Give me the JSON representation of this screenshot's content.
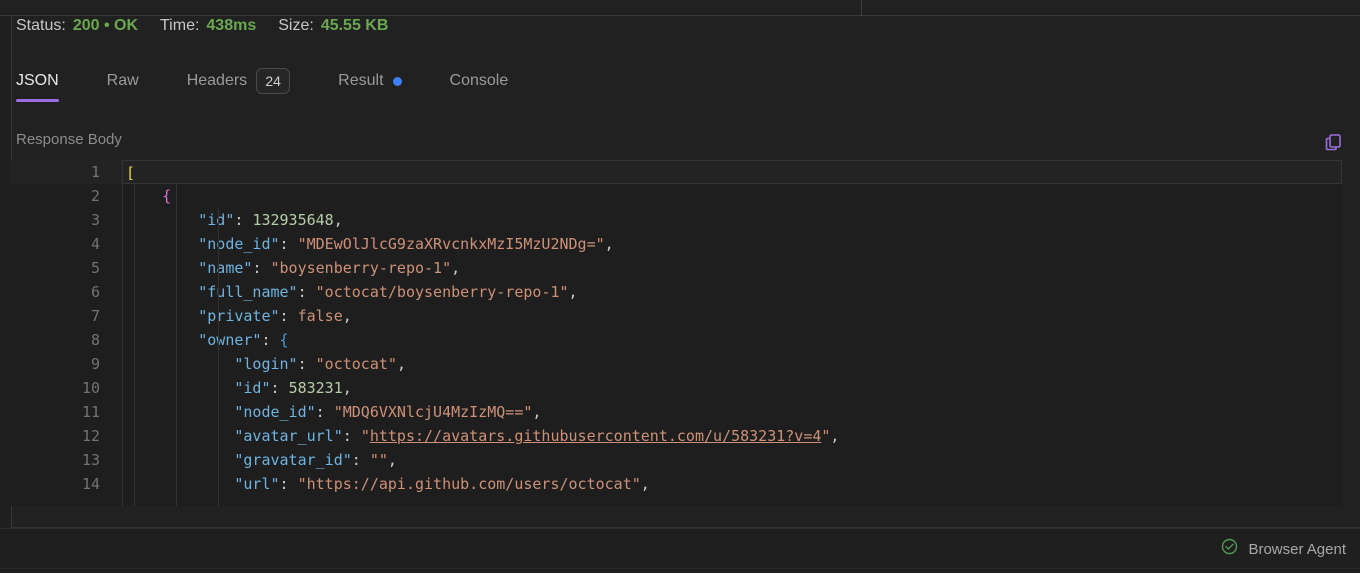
{
  "status_bar": {
    "status_label": "Status:",
    "status_value": "200 • OK",
    "status_color": "#6aa84f",
    "time_label": "Time:",
    "time_value": "438ms",
    "size_label": "Size:",
    "size_value": "45.55 KB"
  },
  "tabs": [
    {
      "label": "JSON",
      "active": true,
      "badge": null,
      "dot": null
    },
    {
      "label": "Raw",
      "active": false,
      "badge": null,
      "dot": null
    },
    {
      "label": "Headers",
      "active": false,
      "badge": "24",
      "dot": null
    },
    {
      "label": "Result",
      "active": false,
      "badge": null,
      "dot": "#3b82f6"
    },
    {
      "label": "Console",
      "active": false,
      "badge": null,
      "dot": null
    }
  ],
  "body_panel": {
    "title": "Response Body",
    "copy_icon": "copy-icon",
    "accent_color": "#9a6ee0"
  },
  "code": {
    "language": "json",
    "current_line": 1,
    "lines": [
      {
        "n": "1",
        "tokens": [
          {
            "t": "[",
            "c": "br0"
          }
        ]
      },
      {
        "n": "2",
        "tokens": [
          {
            "t": "    ",
            "c": "p"
          },
          {
            "t": "{",
            "c": "br1"
          }
        ]
      },
      {
        "n": "3",
        "tokens": [
          {
            "t": "        ",
            "c": "p"
          },
          {
            "t": "\"id\"",
            "c": "k"
          },
          {
            "t": ": ",
            "c": "p"
          },
          {
            "t": "132935648",
            "c": "n"
          },
          {
            "t": ",",
            "c": "p"
          }
        ]
      },
      {
        "n": "4",
        "tokens": [
          {
            "t": "        ",
            "c": "p"
          },
          {
            "t": "\"node_id\"",
            "c": "k"
          },
          {
            "t": ": ",
            "c": "p"
          },
          {
            "t": "\"MDEwOlJlcG9zaXRvcnkxMzI5MzU2NDg=\"",
            "c": "s"
          },
          {
            "t": ",",
            "c": "p"
          }
        ]
      },
      {
        "n": "5",
        "tokens": [
          {
            "t": "        ",
            "c": "p"
          },
          {
            "t": "\"name\"",
            "c": "k"
          },
          {
            "t": ": ",
            "c": "p"
          },
          {
            "t": "\"boysenberry-repo-1\"",
            "c": "s"
          },
          {
            "t": ",",
            "c": "p"
          }
        ]
      },
      {
        "n": "6",
        "tokens": [
          {
            "t": "        ",
            "c": "p"
          },
          {
            "t": "\"full_name\"",
            "c": "k"
          },
          {
            "t": ": ",
            "c": "p"
          },
          {
            "t": "\"octocat/boysenberry-repo-1\"",
            "c": "s"
          },
          {
            "t": ",",
            "c": "p"
          }
        ]
      },
      {
        "n": "7",
        "tokens": [
          {
            "t": "        ",
            "c": "p"
          },
          {
            "t": "\"private\"",
            "c": "k"
          },
          {
            "t": ": ",
            "c": "p"
          },
          {
            "t": "false",
            "c": "b"
          },
          {
            "t": ",",
            "c": "p"
          }
        ]
      },
      {
        "n": "8",
        "tokens": [
          {
            "t": "        ",
            "c": "p"
          },
          {
            "t": "\"owner\"",
            "c": "k"
          },
          {
            "t": ": ",
            "c": "p"
          },
          {
            "t": "{",
            "c": "br2"
          }
        ]
      },
      {
        "n": "9",
        "tokens": [
          {
            "t": "            ",
            "c": "p"
          },
          {
            "t": "\"login\"",
            "c": "k"
          },
          {
            "t": ": ",
            "c": "p"
          },
          {
            "t": "\"octocat\"",
            "c": "s"
          },
          {
            "t": ",",
            "c": "p"
          }
        ]
      },
      {
        "n": "10",
        "tokens": [
          {
            "t": "            ",
            "c": "p"
          },
          {
            "t": "\"id\"",
            "c": "k"
          },
          {
            "t": ": ",
            "c": "p"
          },
          {
            "t": "583231",
            "c": "n"
          },
          {
            "t": ",",
            "c": "p"
          }
        ]
      },
      {
        "n": "11",
        "tokens": [
          {
            "t": "            ",
            "c": "p"
          },
          {
            "t": "\"node_id\"",
            "c": "k"
          },
          {
            "t": ": ",
            "c": "p"
          },
          {
            "t": "\"MDQ6VXNlcjU4MzIzMQ==\"",
            "c": "s"
          },
          {
            "t": ",",
            "c": "p"
          }
        ]
      },
      {
        "n": "12",
        "tokens": [
          {
            "t": "            ",
            "c": "p"
          },
          {
            "t": "\"avatar_url\"",
            "c": "k"
          },
          {
            "t": ": ",
            "c": "p"
          },
          {
            "t": "\"",
            "c": "s"
          },
          {
            "t": "https://avatars.githubusercontent.com/u/583231?v=4",
            "c": "link"
          },
          {
            "t": "\"",
            "c": "s"
          },
          {
            "t": ",",
            "c": "p"
          }
        ]
      },
      {
        "n": "13",
        "tokens": [
          {
            "t": "            ",
            "c": "p"
          },
          {
            "t": "\"gravatar_id\"",
            "c": "k"
          },
          {
            "t": ": ",
            "c": "p"
          },
          {
            "t": "\"\"",
            "c": "s"
          },
          {
            "t": ",",
            "c": "p"
          }
        ]
      },
      {
        "n": "14",
        "tokens": [
          {
            "t": "            ",
            "c": "p"
          },
          {
            "t": "\"url\"",
            "c": "k"
          },
          {
            "t": ": ",
            "c": "p"
          },
          {
            "t": "\"https://api.github.com/users/octocat\"",
            "c": "s"
          },
          {
            "t": ",",
            "c": "p"
          }
        ]
      }
    ]
  },
  "bottom_bar": {
    "agent_label": "Browser Agent",
    "agent_status_icon": "check-circle-icon",
    "agent_status_color": "#4e9a51"
  }
}
